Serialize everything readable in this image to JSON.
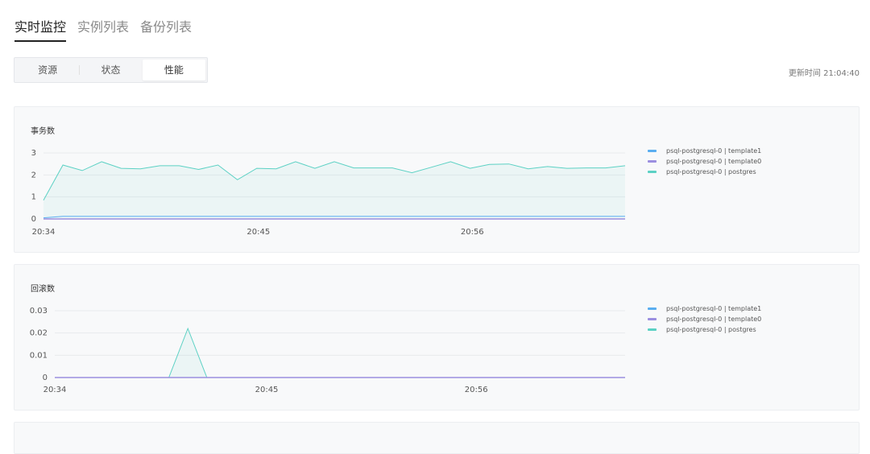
{
  "tabs": [
    "实时监控",
    "实例列表",
    "备份列表"
  ],
  "active_tab": 0,
  "segments": [
    "资源",
    "状态",
    "性能"
  ],
  "active_segment": 2,
  "update_time": "更新时间 21:04:40",
  "colors": {
    "template1": "#5aaef0",
    "template0": "#9b8fe0",
    "postgres": "#5cd1c4"
  },
  "chart_data": [
    {
      "type": "line",
      "title": "事务数",
      "x_ticks": [
        "20:34",
        "20:45",
        "20:56"
      ],
      "ylim": [
        0,
        3
      ],
      "y_ticks": [
        "0",
        "1",
        "2",
        "3"
      ],
      "grid": true,
      "legend_position": "right",
      "series": [
        {
          "name": "psql-postgresql-0 | template1",
          "color": "#5aaef0",
          "values": [
            0.05,
            0.12,
            0.12,
            0.12,
            0.12,
            0.12,
            0.12,
            0.12,
            0.12,
            0.12,
            0.12,
            0.12,
            0.12,
            0.12,
            0.12,
            0.12,
            0.12,
            0.12,
            0.12,
            0.12,
            0.12,
            0.12,
            0.12,
            0.12,
            0.12,
            0.12,
            0.12,
            0.12,
            0.12,
            0.12,
            0.12
          ]
        },
        {
          "name": "psql-postgresql-0 | template0",
          "color": "#9b8fe0",
          "values": [
            0,
            0,
            0,
            0,
            0,
            0,
            0,
            0,
            0,
            0,
            0,
            0,
            0,
            0,
            0,
            0,
            0,
            0,
            0,
            0,
            0,
            0,
            0,
            0,
            0,
            0,
            0,
            0,
            0,
            0,
            0
          ]
        },
        {
          "name": "psql-postgresql-0 | postgres",
          "color": "#5cd1c4",
          "values": [
            0.85,
            2.45,
            2.2,
            2.6,
            2.3,
            2.28,
            2.42,
            2.42,
            2.25,
            2.45,
            1.78,
            2.3,
            2.28,
            2.6,
            2.3,
            2.6,
            2.32,
            2.32,
            2.32,
            2.1,
            2.35,
            2.6,
            2.3,
            2.48,
            2.5,
            2.28,
            2.38,
            2.3,
            2.32,
            2.32,
            2.42
          ]
        }
      ]
    },
    {
      "type": "line",
      "title": "回滚数",
      "x_ticks": [
        "20:34",
        "20:45",
        "20:56"
      ],
      "ylim": [
        0,
        0.03
      ],
      "y_ticks": [
        "0",
        "0.01",
        "0.02",
        "0.03"
      ],
      "grid": true,
      "legend_position": "right",
      "series": [
        {
          "name": "psql-postgresql-0 | template1",
          "color": "#5aaef0",
          "values": [
            0,
            0,
            0,
            0,
            0,
            0,
            0,
            0,
            0,
            0,
            0,
            0,
            0,
            0,
            0,
            0,
            0,
            0,
            0,
            0,
            0,
            0,
            0,
            0,
            0,
            0,
            0,
            0,
            0,
            0,
            0
          ]
        },
        {
          "name": "psql-postgresql-0 | template0",
          "color": "#9b8fe0",
          "values": [
            0,
            0,
            0,
            0,
            0,
            0,
            0,
            0,
            0,
            0,
            0,
            0,
            0,
            0,
            0,
            0,
            0,
            0,
            0,
            0,
            0,
            0,
            0,
            0,
            0,
            0,
            0,
            0,
            0,
            0,
            0
          ]
        },
        {
          "name": "psql-postgresql-0 | postgres",
          "color": "#5cd1c4",
          "values": [
            0,
            0,
            0,
            0,
            0,
            0,
            0,
            0.022,
            0,
            0,
            0,
            0,
            0,
            0,
            0,
            0,
            0,
            0,
            0,
            0,
            0,
            0,
            0,
            0,
            0,
            0,
            0,
            0,
            0,
            0,
            0
          ]
        }
      ]
    }
  ]
}
